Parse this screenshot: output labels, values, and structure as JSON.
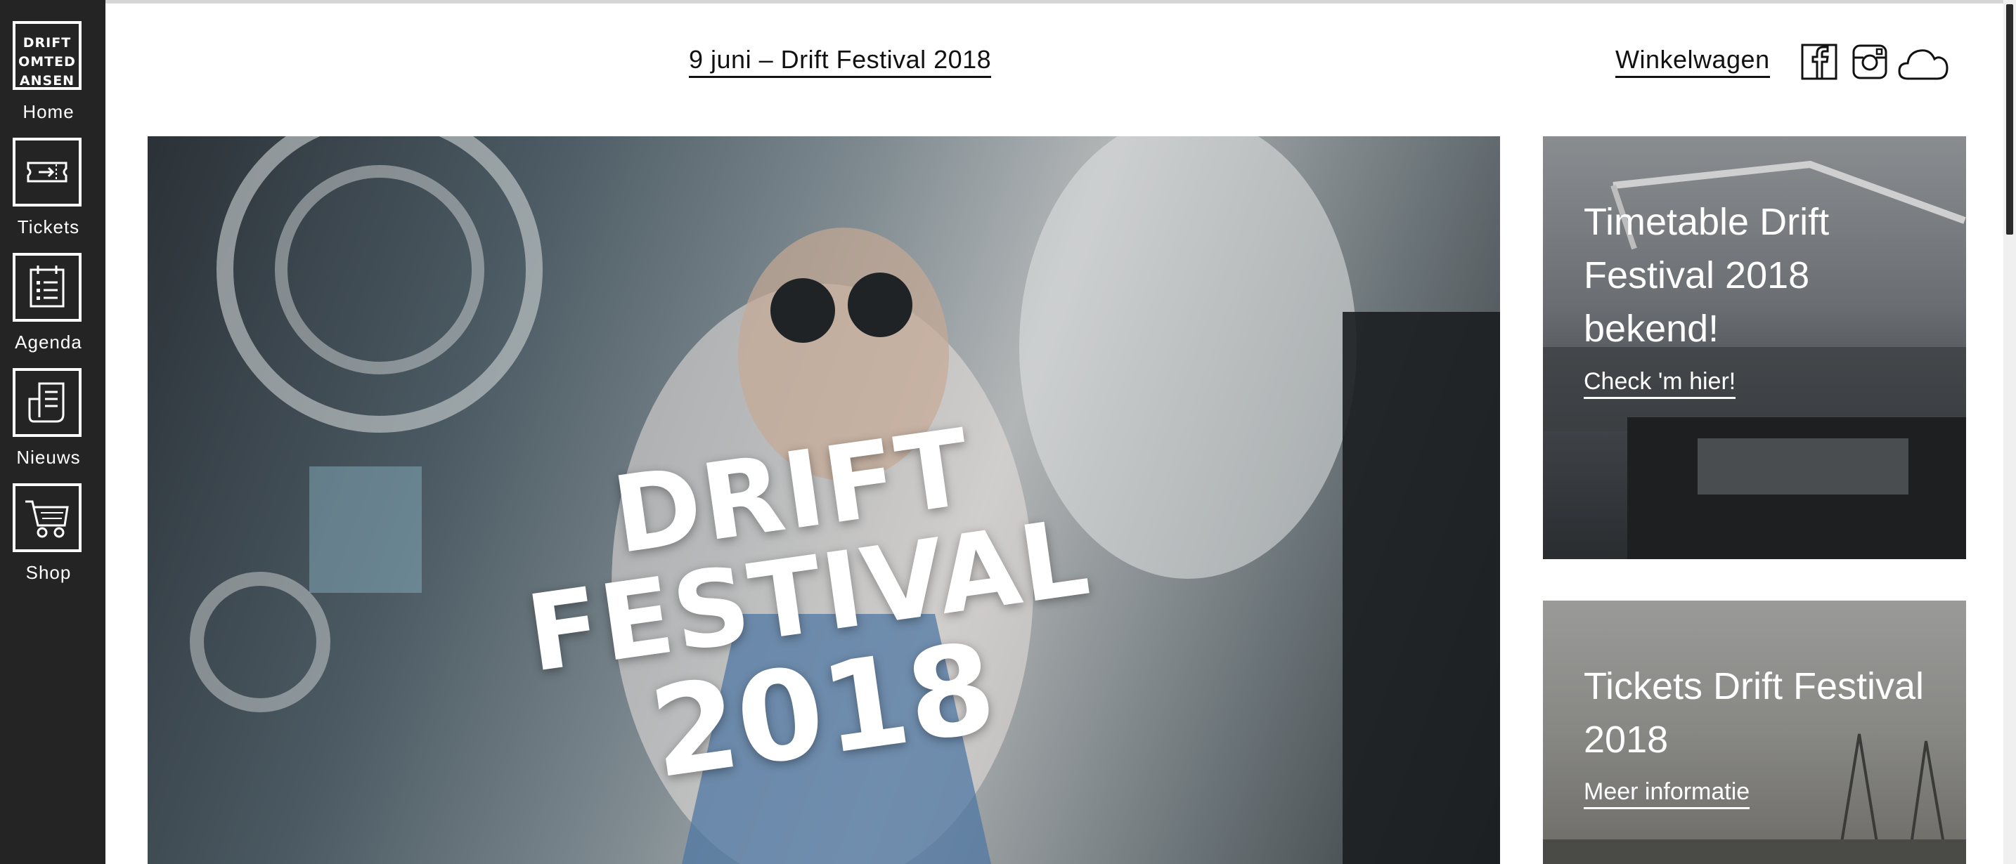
{
  "sidebar": {
    "logo": {
      "lines": [
        "DRIFT",
        "OMTED",
        "ANSEN"
      ],
      "icon": "drift-logo"
    },
    "items": [
      {
        "label": "Home",
        "icon": "home-logo-icon"
      },
      {
        "label": "Tickets",
        "icon": "ticket-icon"
      },
      {
        "label": "Agenda",
        "icon": "calendar-icon"
      },
      {
        "label": "Nieuws",
        "icon": "newspaper-icon"
      },
      {
        "label": "Shop",
        "icon": "cart-icon"
      }
    ]
  },
  "header": {
    "event_link": "9 juni – Drift Festival 2018",
    "cart_label": "Winkelwagen",
    "social": [
      "facebook-icon",
      "instagram-icon",
      "soundcloud-icon"
    ]
  },
  "hero": {
    "title_line1": "DRIFT FESTIVAL",
    "title_line2": "2018"
  },
  "cards": [
    {
      "title": "Timetable Drift Festival 2018 bekend!",
      "link": "Check 'm hier!"
    },
    {
      "title": "Tickets Drift Festival 2018",
      "link": "Meer informatie"
    }
  ],
  "colors": {
    "sidebar": "#242424",
    "text": "#111111",
    "accent": "#ffffff"
  }
}
